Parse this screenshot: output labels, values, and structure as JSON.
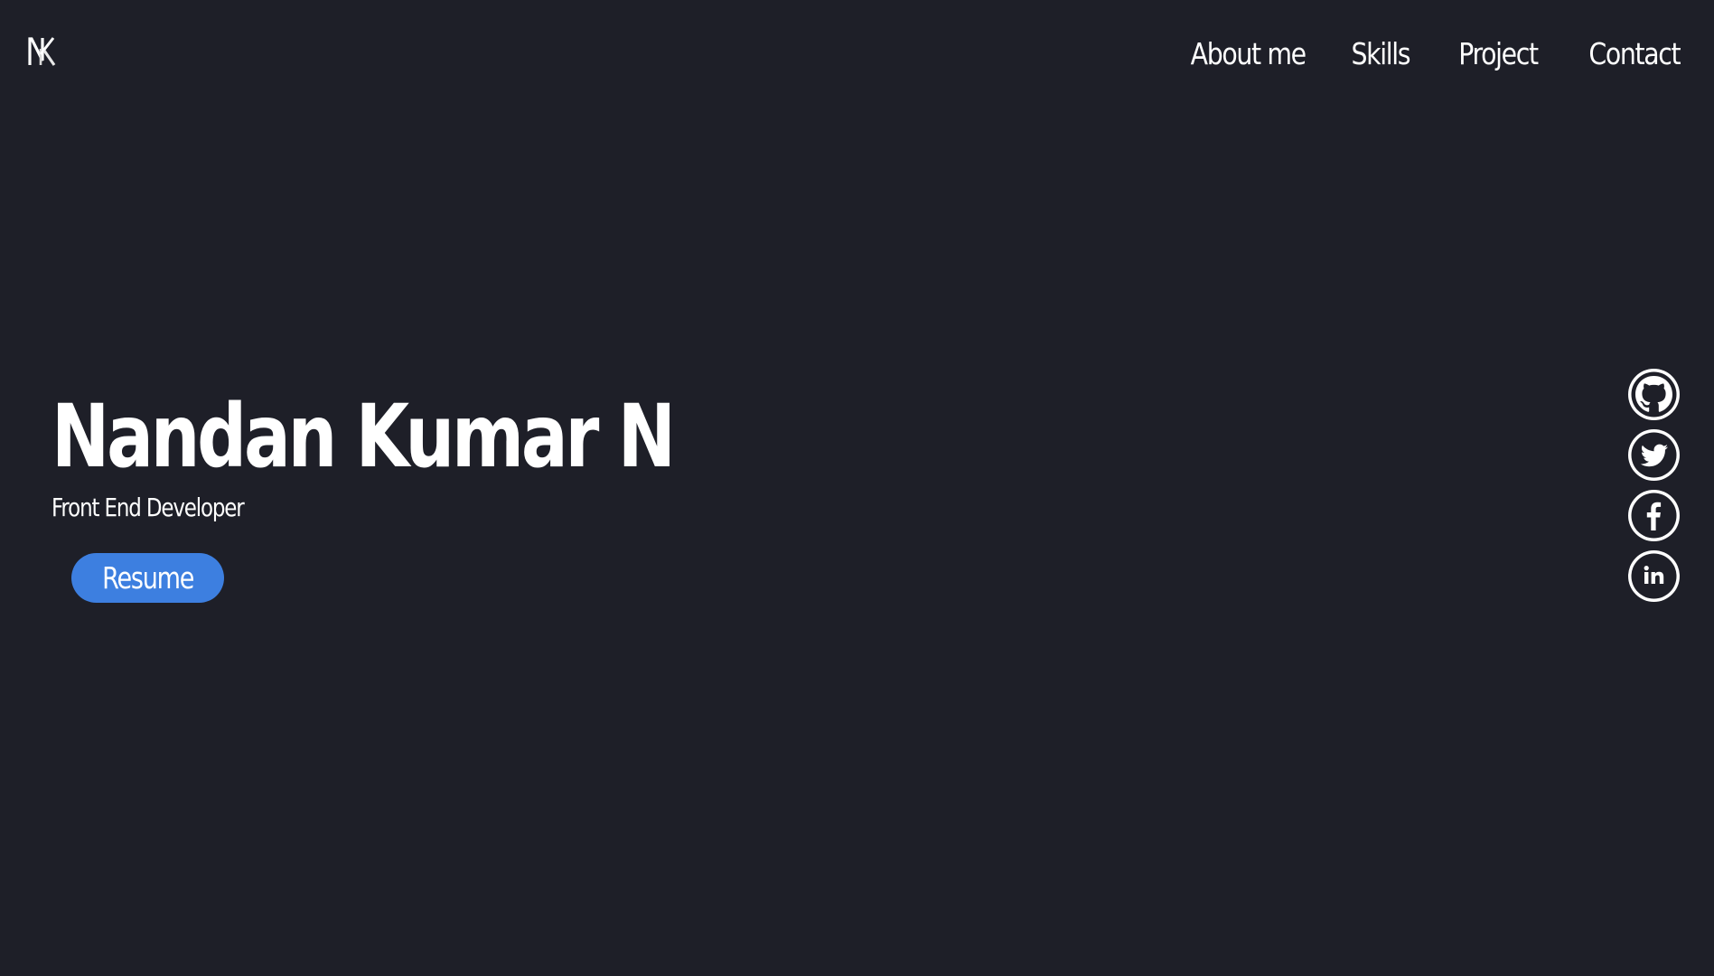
{
  "logo": {
    "text": "NK",
    "icon": "nk-logo-icon"
  },
  "nav": {
    "items": [
      {
        "label": "About me"
      },
      {
        "label": "Skills"
      },
      {
        "label": "Project"
      },
      {
        "label": "Contact"
      }
    ]
  },
  "hero": {
    "name": "Nandan Kumar N",
    "role": "Front End Developer",
    "resume_label": "Resume"
  },
  "social": [
    {
      "icon": "github-icon"
    },
    {
      "icon": "twitter-icon"
    },
    {
      "icon": "facebook-icon"
    },
    {
      "icon": "linkedin-icon"
    }
  ],
  "colors": {
    "background": "#1e1f28",
    "text": "#ffffff",
    "accent": "#3d7fe0"
  }
}
